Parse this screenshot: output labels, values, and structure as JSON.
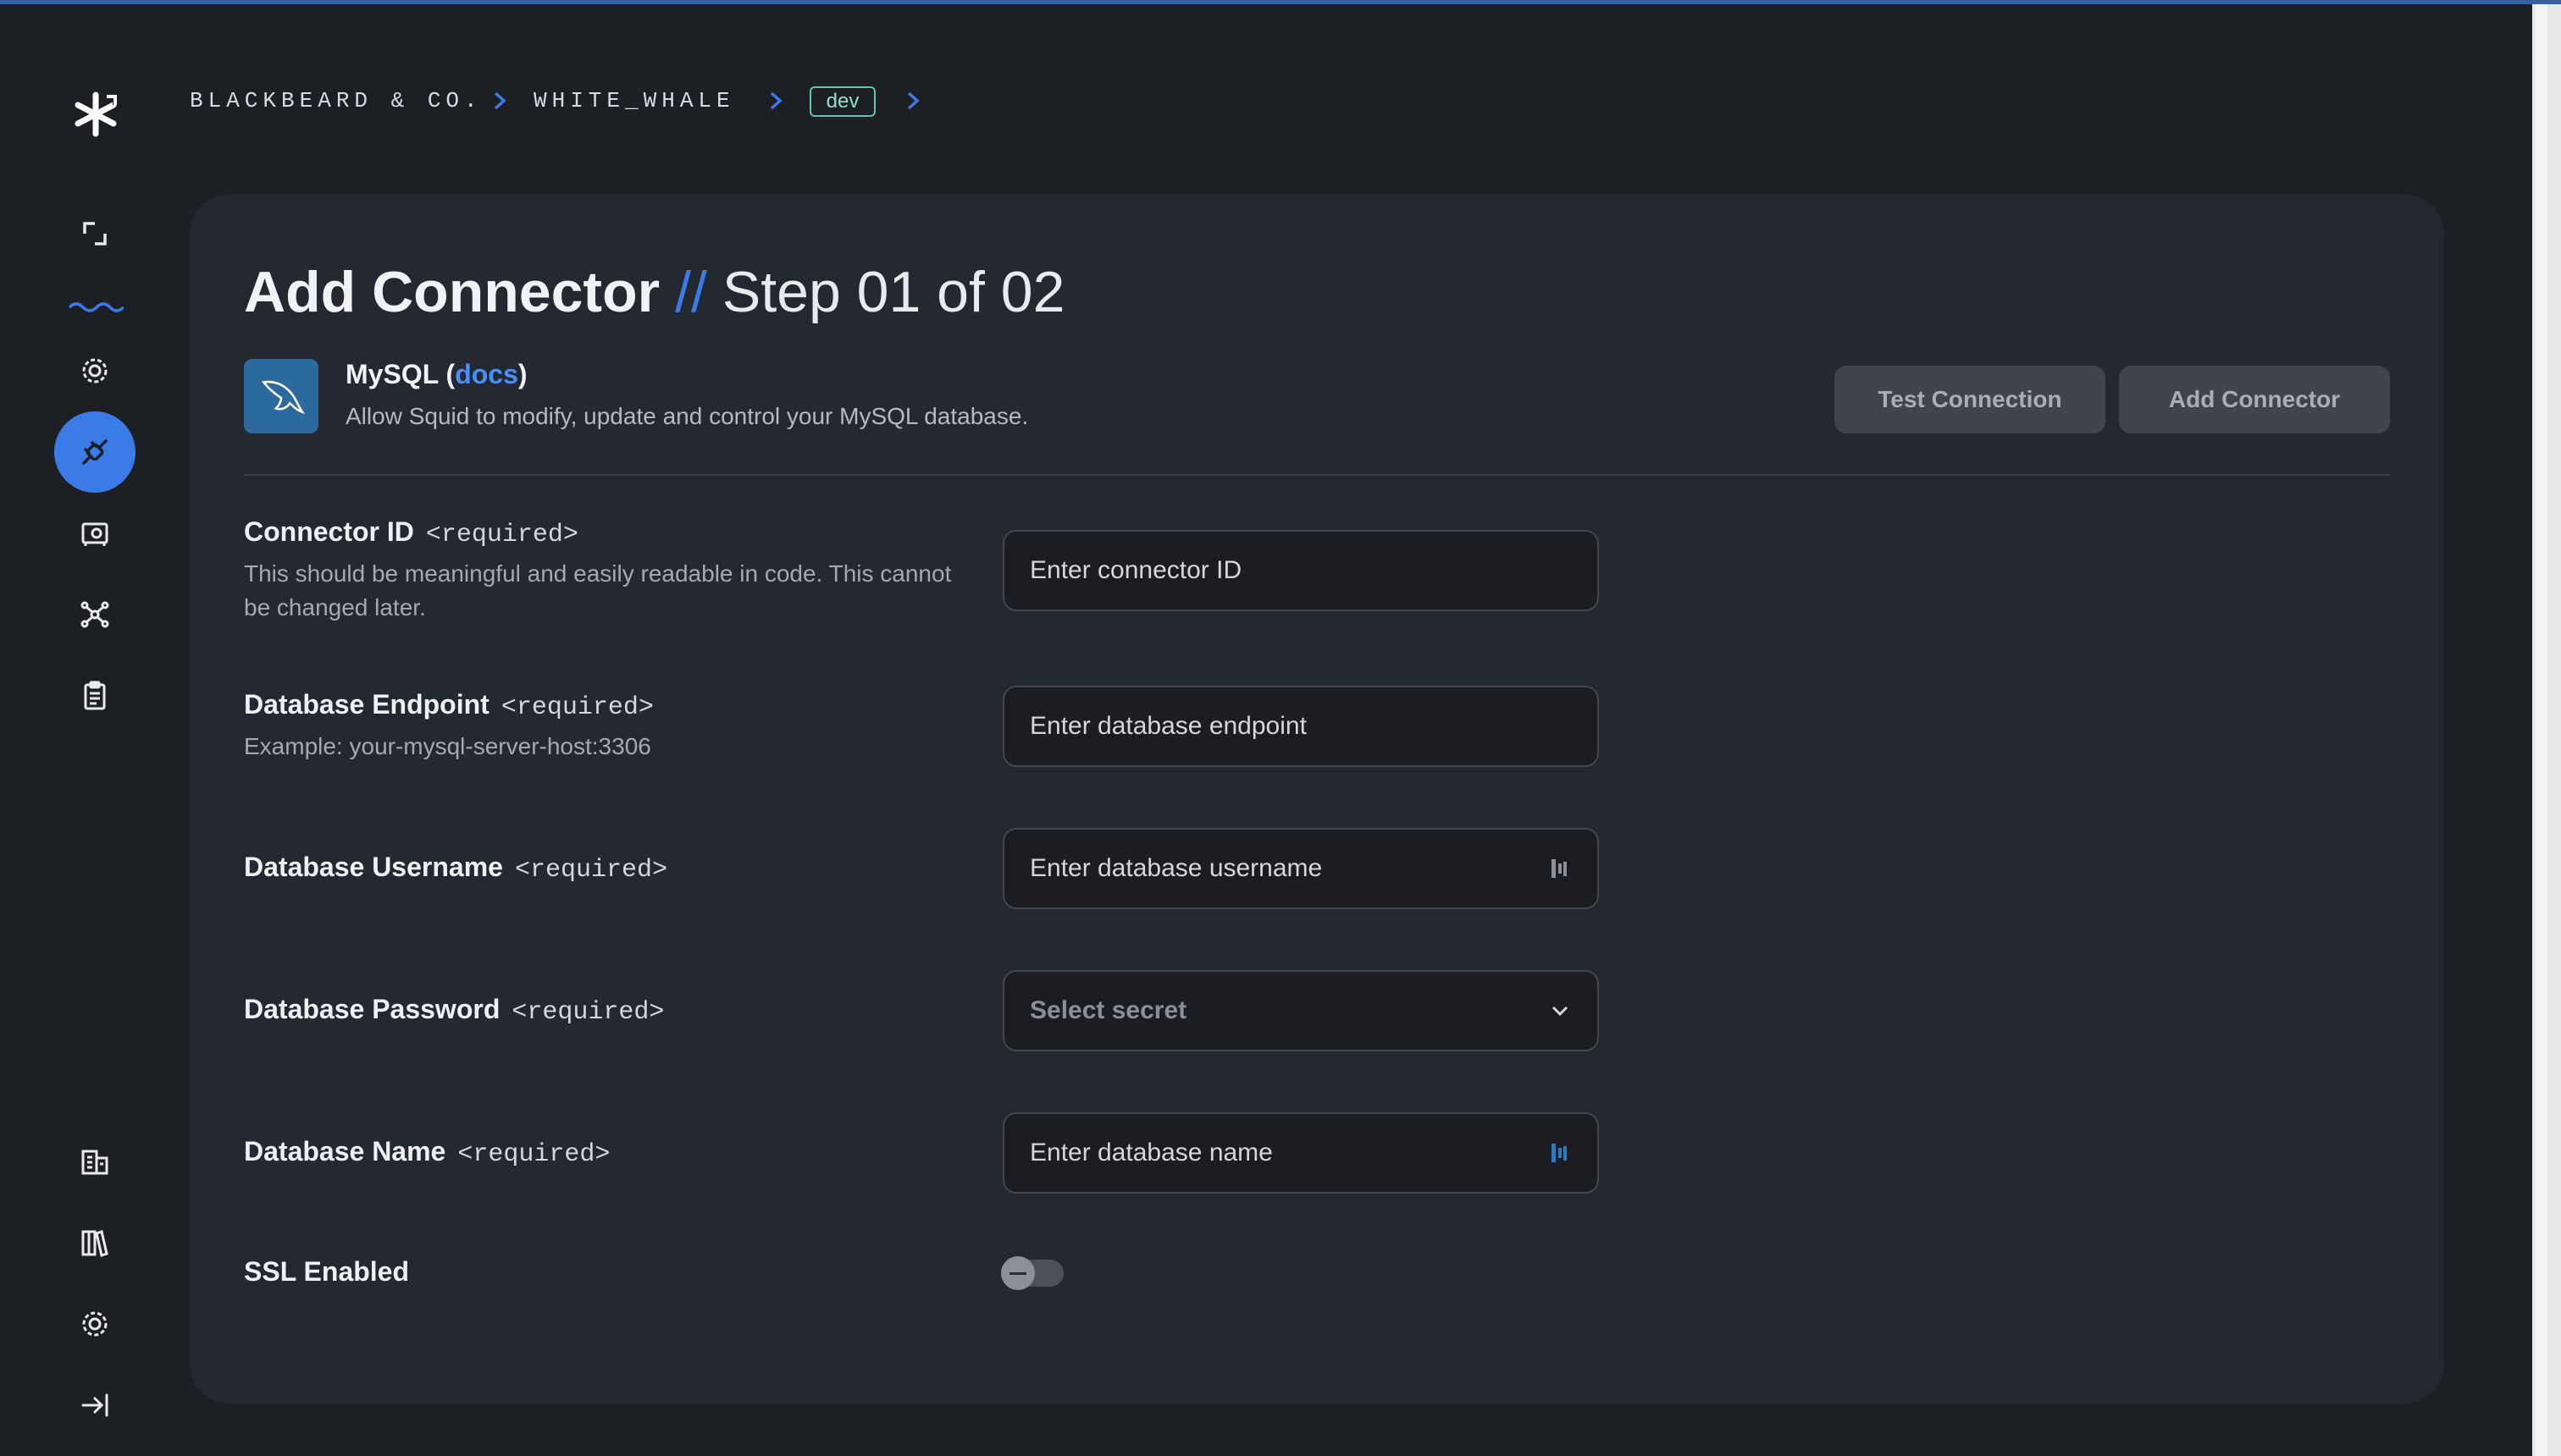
{
  "breadcrumb": {
    "org": "BLACKBEARD & CO.",
    "project": "WHITE_WHALE",
    "environment": "dev"
  },
  "sidebar": {
    "items": [
      {
        "icon": "expand-icon"
      },
      {
        "icon": "waves-icon"
      },
      {
        "icon": "gear-icon"
      },
      {
        "icon": "plug-icon",
        "active": true
      },
      {
        "icon": "vault-icon"
      },
      {
        "icon": "network-icon"
      },
      {
        "icon": "clipboard-icon"
      }
    ],
    "bottom_items": [
      {
        "icon": "building-icon"
      },
      {
        "icon": "books-icon"
      },
      {
        "icon": "settings-icon"
      },
      {
        "icon": "logout-icon"
      }
    ]
  },
  "page": {
    "title": "Add Connector",
    "separator": "//",
    "step": "Step 01 of 02"
  },
  "connector": {
    "name": "MySQL (",
    "docs_label": "docs",
    "name_close": ")",
    "description": "Allow Squid to modify, update and control your MySQL database.",
    "logo_icon": "mysql-dolphin-icon"
  },
  "actions": {
    "test_label": "Test Connection",
    "add_label": "Add Connector"
  },
  "form": {
    "connector_id": {
      "label": "Connector ID",
      "required": "<required>",
      "help": "This should be meaningful and easily readable in code. This cannot be changed later.",
      "placeholder": "Enter connector ID"
    },
    "endpoint": {
      "label": "Database Endpoint",
      "required": "<required>",
      "help": "Example: your-mysql-server-host:3306",
      "placeholder": "Enter database endpoint"
    },
    "username": {
      "label": "Database Username",
      "required": "<required>",
      "placeholder": "Enter database username"
    },
    "password": {
      "label": "Database Password",
      "required": "<required>",
      "placeholder": "Select secret"
    },
    "db_name": {
      "label": "Database Name",
      "required": "<required>",
      "placeholder": "Enter database name"
    },
    "ssl": {
      "label": "SSL Enabled",
      "enabled": false
    }
  },
  "colors": {
    "accent": "#3b7be8",
    "badge": "#5fc6b0",
    "background": "#1c1f24",
    "card": "#242830"
  }
}
